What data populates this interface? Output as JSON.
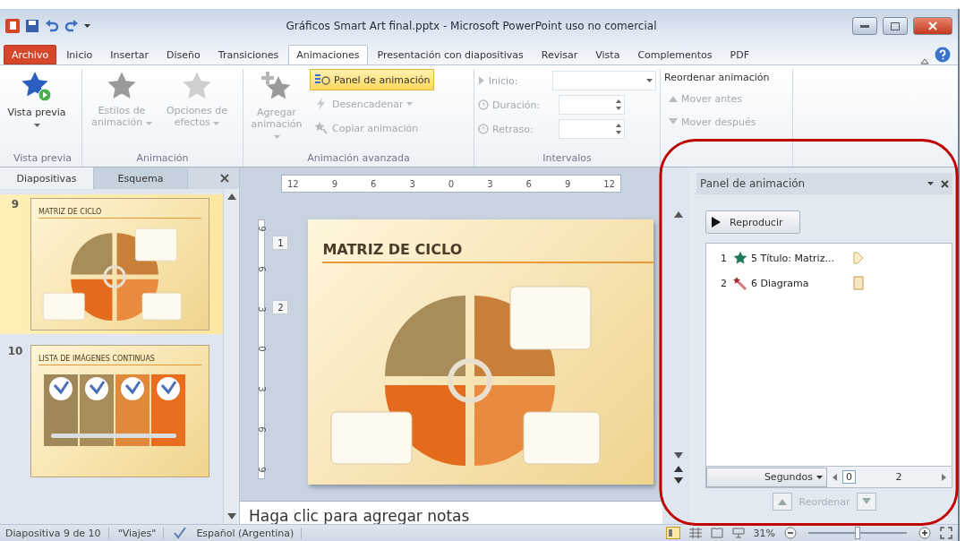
{
  "window": {
    "title": "Gráficos Smart Art final.pptx  -  Microsoft PowerPoint uso no comercial"
  },
  "ribbon_tabs": [
    {
      "label": "Archivo",
      "kind": "file",
      "selected": false
    },
    {
      "label": "Inicio",
      "kind": "tab",
      "selected": false
    },
    {
      "label": "Insertar",
      "kind": "tab",
      "selected": false
    },
    {
      "label": "Diseño",
      "kind": "tab",
      "selected": false
    },
    {
      "label": "Transiciones",
      "kind": "tab",
      "selected": false
    },
    {
      "label": "Animaciones",
      "kind": "tab",
      "selected": true
    },
    {
      "label": "Presentación con diapositivas",
      "kind": "tab",
      "selected": false
    },
    {
      "label": "Revisar",
      "kind": "tab",
      "selected": false
    },
    {
      "label": "Vista",
      "kind": "tab",
      "selected": false
    },
    {
      "label": "Complementos",
      "kind": "tab",
      "selected": false
    },
    {
      "label": "PDF",
      "kind": "tab",
      "selected": false
    }
  ],
  "ribbon": {
    "preview_group": {
      "label": "Vista previa",
      "button": {
        "label": "Vista previa",
        "disabled": false
      }
    },
    "animation_group": {
      "label": "Animación",
      "buttons": [
        {
          "label": "Estilos de animación",
          "disabled": true
        },
        {
          "label": "Opciones de efectos",
          "disabled": true
        }
      ]
    },
    "advanced_group": {
      "label": "Animación avanzada",
      "large_button": {
        "label": "Agregar animación",
        "disabled": true
      },
      "small_buttons": [
        {
          "label": "Panel de animación",
          "selected": true,
          "disabled": false,
          "dropdown": false
        },
        {
          "label": "Desencadenar",
          "selected": false,
          "disabled": true,
          "dropdown": true
        },
        {
          "label": "Copiar animación",
          "selected": false,
          "disabled": true,
          "dropdown": false
        }
      ]
    },
    "timing_group": {
      "label": "Intervalos",
      "fields": [
        {
          "label": "Inicio:",
          "kind": "dropdown",
          "disabled": true
        },
        {
          "label": "Duración:",
          "kind": "spinner",
          "disabled": true
        },
        {
          "label": "Retraso:",
          "kind": "spinner",
          "disabled": true
        }
      ]
    },
    "reorder_group": {
      "title": "Reordenar animación",
      "buttons": [
        {
          "label": "Mover antes",
          "kind": "up",
          "disabled": true
        },
        {
          "label": "Mover después",
          "kind": "down",
          "disabled": true
        }
      ]
    }
  },
  "slides_pane": {
    "tabs": [
      {
        "label": "Diapositivas",
        "selected": true
      },
      {
        "label": "Esquema",
        "selected": false
      }
    ],
    "slides": [
      {
        "number": "9",
        "title": "MATRIZ DE CICLO",
        "kind": "cycle",
        "selected": true
      },
      {
        "number": "10",
        "title": "LISTA DE IMÁGENES CONTINUAS",
        "kind": "pictures",
        "selected": false
      }
    ]
  },
  "editor": {
    "ruler": [
      "12",
      "9",
      "6",
      "3",
      "0",
      "3",
      "6",
      "9",
      "12"
    ],
    "vertical_ruler": [
      "9",
      "6",
      "3",
      "0",
      "3",
      "6",
      "9"
    ],
    "slide": {
      "title": "MATRIZ DE CICLO",
      "animation_tags": [
        "1",
        "2"
      ]
    },
    "notes": {
      "placeholder": "Haga clic para agregar notas"
    }
  },
  "animation_pane": {
    "title": "Panel de animación",
    "play_button": "Reproducir",
    "items": [
      {
        "order": "1",
        "label": "5 Título: Matriz...",
        "kind": "entrance"
      },
      {
        "order": "2",
        "label": "6 Diagrama",
        "kind": "emphasis"
      }
    ],
    "timeline": {
      "unit": "Segundos",
      "start": "0",
      "end": "2"
    },
    "reorder_label": "Reordenar"
  },
  "status_bar": {
    "slide_info": "Diapositiva 9 de 10",
    "theme": "\"Viajes\"",
    "language": "Español (Argentina)",
    "zoom": "31%",
    "zoom_slider": {
      "level": 0.5
    }
  }
}
